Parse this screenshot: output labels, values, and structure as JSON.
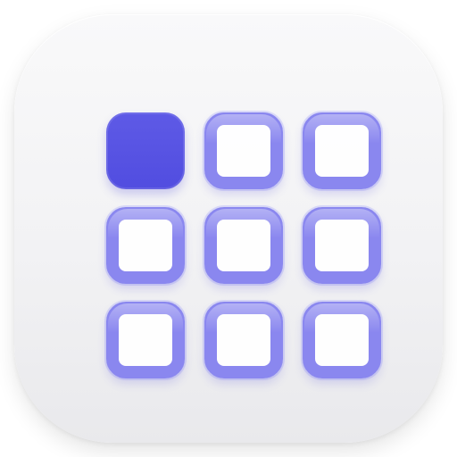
{
  "app_icon": {
    "name": "grid-launcher",
    "colors": {
      "tile": "#f3f3f5",
      "accent": "#5754e3",
      "outline": "#8a87ef"
    },
    "grid": {
      "rows": 3,
      "columns": 3,
      "cells": [
        {
          "state": "filled"
        },
        {
          "state": "outline"
        },
        {
          "state": "outline"
        },
        {
          "state": "outline"
        },
        {
          "state": "outline"
        },
        {
          "state": "outline"
        },
        {
          "state": "outline"
        },
        {
          "state": "outline"
        },
        {
          "state": "outline"
        }
      ]
    }
  }
}
